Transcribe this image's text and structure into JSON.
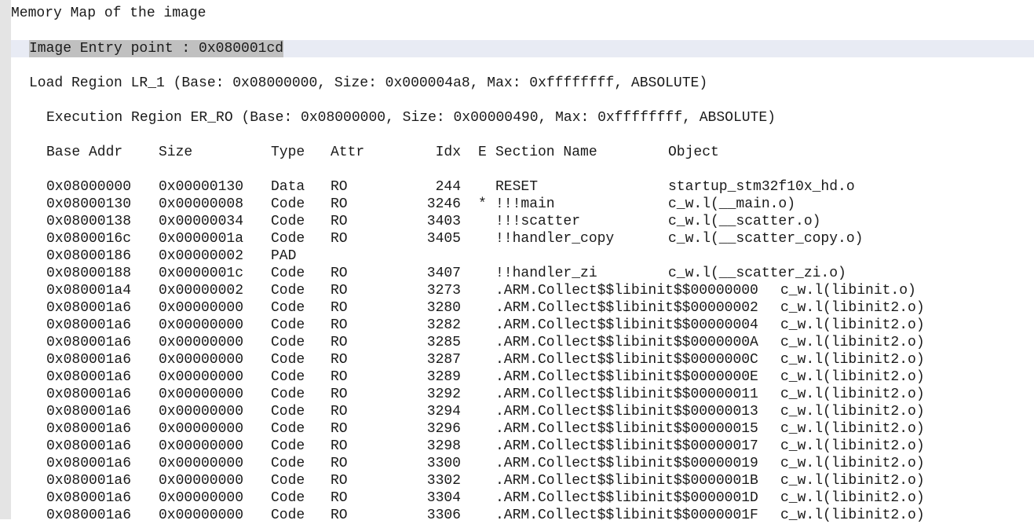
{
  "title": "Memory Map of the image",
  "entry_point": "Image Entry point : 0x080001cd",
  "load_region": "Load Region LR_1 (Base: 0x08000000, Size: 0x000004a8, Max: 0xffffffff, ABSOLUTE)",
  "exec_region": "Execution Region ER_RO (Base: 0x08000000, Size: 0x00000490, Max: 0xffffffff, ABSOLUTE)",
  "columns": {
    "base": "Base Addr",
    "size": "Size",
    "type": "Type",
    "attr": "Attr",
    "idx": "Idx",
    "e": "E",
    "section": "Section Name",
    "object": "Object"
  },
  "rows": [
    {
      "base": "0x08000000",
      "size": "0x00000130",
      "type": "Data",
      "attr": "RO",
      "idx": "244",
      "e": "",
      "section": "RESET",
      "object": "startup_stm32f10x_hd.o"
    },
    {
      "base": "0x08000130",
      "size": "0x00000008",
      "type": "Code",
      "attr": "RO",
      "idx": "3246",
      "e": "*",
      "section": "!!!main",
      "object": "c_w.l(__main.o)"
    },
    {
      "base": "0x08000138",
      "size": "0x00000034",
      "type": "Code",
      "attr": "RO",
      "idx": "3403",
      "e": "",
      "section": "!!!scatter",
      "object": "c_w.l(__scatter.o)"
    },
    {
      "base": "0x0800016c",
      "size": "0x0000001a",
      "type": "Code",
      "attr": "RO",
      "idx": "3405",
      "e": "",
      "section": "!!handler_copy",
      "object": "c_w.l(__scatter_copy.o)"
    },
    {
      "base": "0x08000186",
      "size": "0x00000002",
      "type": "PAD",
      "attr": "",
      "idx": "",
      "e": "",
      "section": "",
      "object": ""
    },
    {
      "base": "0x08000188",
      "size": "0x0000001c",
      "type": "Code",
      "attr": "RO",
      "idx": "3407",
      "e": "",
      "section": "!!handler_zi",
      "object": "c_w.l(__scatter_zi.o)"
    },
    {
      "base": "0x080001a4",
      "size": "0x00000002",
      "type": "Code",
      "attr": "RO",
      "idx": "3273",
      "e": "",
      "section": ".ARM.Collect$$libinit$$00000000",
      "object": "c_w.l(libinit.o)"
    },
    {
      "base": "0x080001a6",
      "size": "0x00000000",
      "type": "Code",
      "attr": "RO",
      "idx": "3280",
      "e": "",
      "section": ".ARM.Collect$$libinit$$00000002",
      "object": "c_w.l(libinit2.o)"
    },
    {
      "base": "0x080001a6",
      "size": "0x00000000",
      "type": "Code",
      "attr": "RO",
      "idx": "3282",
      "e": "",
      "section": ".ARM.Collect$$libinit$$00000004",
      "object": "c_w.l(libinit2.o)"
    },
    {
      "base": "0x080001a6",
      "size": "0x00000000",
      "type": "Code",
      "attr": "RO",
      "idx": "3285",
      "e": "",
      "section": ".ARM.Collect$$libinit$$0000000A",
      "object": "c_w.l(libinit2.o)"
    },
    {
      "base": "0x080001a6",
      "size": "0x00000000",
      "type": "Code",
      "attr": "RO",
      "idx": "3287",
      "e": "",
      "section": ".ARM.Collect$$libinit$$0000000C",
      "object": "c_w.l(libinit2.o)"
    },
    {
      "base": "0x080001a6",
      "size": "0x00000000",
      "type": "Code",
      "attr": "RO",
      "idx": "3289",
      "e": "",
      "section": ".ARM.Collect$$libinit$$0000000E",
      "object": "c_w.l(libinit2.o)"
    },
    {
      "base": "0x080001a6",
      "size": "0x00000000",
      "type": "Code",
      "attr": "RO",
      "idx": "3292",
      "e": "",
      "section": ".ARM.Collect$$libinit$$00000011",
      "object": "c_w.l(libinit2.o)"
    },
    {
      "base": "0x080001a6",
      "size": "0x00000000",
      "type": "Code",
      "attr": "RO",
      "idx": "3294",
      "e": "",
      "section": ".ARM.Collect$$libinit$$00000013",
      "object": "c_w.l(libinit2.o)"
    },
    {
      "base": "0x080001a6",
      "size": "0x00000000",
      "type": "Code",
      "attr": "RO",
      "idx": "3296",
      "e": "",
      "section": ".ARM.Collect$$libinit$$00000015",
      "object": "c_w.l(libinit2.o)"
    },
    {
      "base": "0x080001a6",
      "size": "0x00000000",
      "type": "Code",
      "attr": "RO",
      "idx": "3298",
      "e": "",
      "section": ".ARM.Collect$$libinit$$00000017",
      "object": "c_w.l(libinit2.o)"
    },
    {
      "base": "0x080001a6",
      "size": "0x00000000",
      "type": "Code",
      "attr": "RO",
      "idx": "3300",
      "e": "",
      "section": ".ARM.Collect$$libinit$$00000019",
      "object": "c_w.l(libinit2.o)"
    },
    {
      "base": "0x080001a6",
      "size": "0x00000000",
      "type": "Code",
      "attr": "RO",
      "idx": "3302",
      "e": "",
      "section": ".ARM.Collect$$libinit$$0000001B",
      "object": "c_w.l(libinit2.o)"
    },
    {
      "base": "0x080001a6",
      "size": "0x00000000",
      "type": "Code",
      "attr": "RO",
      "idx": "3304",
      "e": "",
      "section": ".ARM.Collect$$libinit$$0000001D",
      "object": "c_w.l(libinit2.o)"
    },
    {
      "base": "0x080001a6",
      "size": "0x00000000",
      "type": "Code",
      "attr": "RO",
      "idx": "3306",
      "e": "",
      "section": ".ARM.Collect$$libinit$$0000001F",
      "object": "c_w.l(libinit2.o)"
    }
  ]
}
